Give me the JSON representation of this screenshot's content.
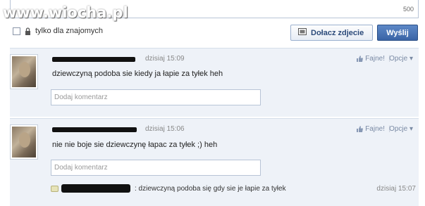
{
  "watermark": "www.wiocha.pl",
  "composer": {
    "counter": "500"
  },
  "privacy": {
    "label": "tylko dla znajomych"
  },
  "buttons": {
    "photo": "Dołacz zdjecie",
    "send": "Wyślij"
  },
  "posts": [
    {
      "time": "dzisiaj 15:09",
      "text": "dziewczyną podoba sie kiedy ja łapie za tyłek heh",
      "like": "Fajne!",
      "options": "Opcje",
      "comment_placeholder": "Dodaj komentarz"
    },
    {
      "time": "dzisiaj 15:06",
      "text": "nie nie boje sie dziewczynę łapac za tyłek ;) heh",
      "like": "Fajne!",
      "options": "Opcje",
      "comment_placeholder": "Dodaj komentarz",
      "reply": {
        "text": ": dziewczyną podoba się gdy sie je łapie za tyłek",
        "time": "dzisiaj 15:07"
      }
    }
  ],
  "colors": {
    "accent": "#3a64a6",
    "post_bg": "#eef2f8",
    "link": "#7a8aa4"
  },
  "icons": [
    "lock-icon",
    "photo-icon",
    "thumbs-up-icon",
    "comment-bubble-icon"
  ]
}
